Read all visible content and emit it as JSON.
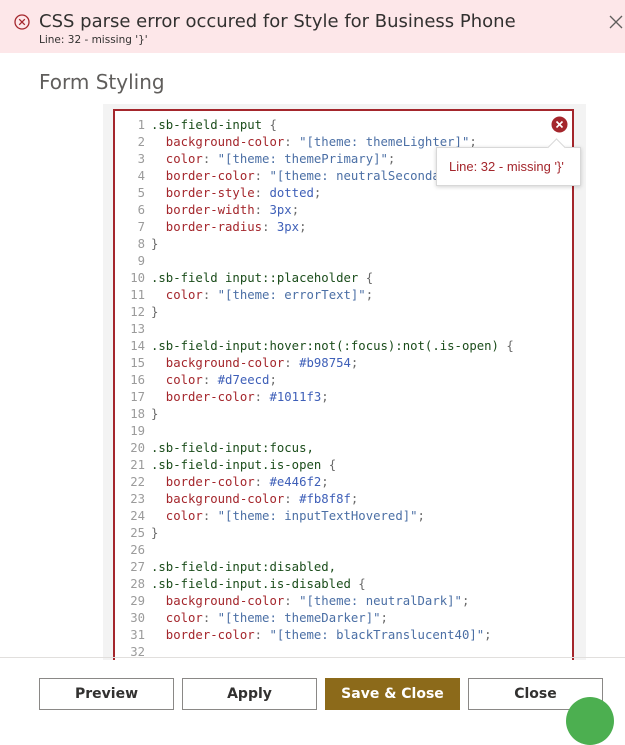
{
  "banner": {
    "title": "CSS parse error occured for Style for Business Phone",
    "subtitle": "Line: 32 - missing '}'",
    "icon": "error-circle-icon",
    "close_icon": "close-icon",
    "bg_color": "#fde7e9"
  },
  "section": {
    "title": "Form Styling"
  },
  "editor": {
    "error_tooltip": "Line: 32 - missing '}'",
    "border_color": "#a4262c",
    "lines": [
      {
        "n": "1",
        "segs": [
          [
            "sel",
            ".sb-field-input "
          ],
          [
            "brace",
            "{"
          ]
        ]
      },
      {
        "n": "2",
        "segs": [
          [
            "prop",
            "  background-color"
          ],
          [
            "punc",
            ": "
          ],
          [
            "str",
            "\"[theme: themeLighter]\""
          ],
          [
            "punc",
            ";"
          ]
        ]
      },
      {
        "n": "3",
        "segs": [
          [
            "prop",
            "  color"
          ],
          [
            "punc",
            ": "
          ],
          [
            "str",
            "\"[theme: themePrimary]\""
          ],
          [
            "punc",
            ";"
          ]
        ]
      },
      {
        "n": "4",
        "segs": [
          [
            "prop",
            "  border-color"
          ],
          [
            "punc",
            ": "
          ],
          [
            "str",
            "\"[theme: neutralSecondary]\""
          ],
          [
            "punc",
            ";"
          ]
        ]
      },
      {
        "n": "5",
        "segs": [
          [
            "prop",
            "  border-style"
          ],
          [
            "punc",
            ": "
          ],
          [
            "val",
            "dotted"
          ],
          [
            "punc",
            ";"
          ]
        ]
      },
      {
        "n": "6",
        "segs": [
          [
            "prop",
            "  border-width"
          ],
          [
            "punc",
            ": "
          ],
          [
            "val",
            "3px"
          ],
          [
            "punc",
            ";"
          ]
        ]
      },
      {
        "n": "7",
        "segs": [
          [
            "prop",
            "  border-radius"
          ],
          [
            "punc",
            ": "
          ],
          [
            "val",
            "3px"
          ],
          [
            "punc",
            ";"
          ]
        ]
      },
      {
        "n": "8",
        "segs": [
          [
            "brace",
            "}"
          ]
        ]
      },
      {
        "n": "9",
        "segs": []
      },
      {
        "n": "10",
        "segs": [
          [
            "sel",
            ".sb-field input::placeholder "
          ],
          [
            "brace",
            "{"
          ]
        ]
      },
      {
        "n": "11",
        "segs": [
          [
            "prop",
            "  color"
          ],
          [
            "punc",
            ": "
          ],
          [
            "str",
            "\"[theme: errorText]\""
          ],
          [
            "punc",
            ";"
          ]
        ]
      },
      {
        "n": "12",
        "segs": [
          [
            "brace",
            "}"
          ]
        ]
      },
      {
        "n": "13",
        "segs": []
      },
      {
        "n": "14",
        "segs": [
          [
            "sel",
            ".sb-field-input:hover:not(:focus):not(.is-open) "
          ],
          [
            "brace",
            "{"
          ]
        ]
      },
      {
        "n": "15",
        "segs": [
          [
            "prop",
            "  background-color"
          ],
          [
            "punc",
            ": "
          ],
          [
            "val",
            "#b98754"
          ],
          [
            "punc",
            ";"
          ]
        ]
      },
      {
        "n": "16",
        "segs": [
          [
            "prop",
            "  color"
          ],
          [
            "punc",
            ": "
          ],
          [
            "val",
            "#d7eecd"
          ],
          [
            "punc",
            ";"
          ]
        ]
      },
      {
        "n": "17",
        "segs": [
          [
            "prop",
            "  border-color"
          ],
          [
            "punc",
            ": "
          ],
          [
            "val",
            "#1011f3"
          ],
          [
            "punc",
            ";"
          ]
        ]
      },
      {
        "n": "18",
        "segs": [
          [
            "brace",
            "}"
          ]
        ]
      },
      {
        "n": "19",
        "segs": []
      },
      {
        "n": "20",
        "segs": [
          [
            "sel",
            ".sb-field-input:focus,"
          ]
        ]
      },
      {
        "n": "21",
        "segs": [
          [
            "sel",
            ".sb-field-input.is-open "
          ],
          [
            "brace",
            "{"
          ]
        ]
      },
      {
        "n": "22",
        "segs": [
          [
            "prop",
            "  border-color"
          ],
          [
            "punc",
            ": "
          ],
          [
            "val",
            "#e446f2"
          ],
          [
            "punc",
            ";"
          ]
        ]
      },
      {
        "n": "23",
        "segs": [
          [
            "prop",
            "  background-color"
          ],
          [
            "punc",
            ": "
          ],
          [
            "val",
            "#fb8f8f"
          ],
          [
            "punc",
            ";"
          ]
        ]
      },
      {
        "n": "24",
        "segs": [
          [
            "prop",
            "  color"
          ],
          [
            "punc",
            ": "
          ],
          [
            "str",
            "\"[theme: inputTextHovered]\""
          ],
          [
            "punc",
            ";"
          ]
        ]
      },
      {
        "n": "25",
        "segs": [
          [
            "brace",
            "}"
          ]
        ]
      },
      {
        "n": "26",
        "segs": []
      },
      {
        "n": "27",
        "segs": [
          [
            "sel",
            ".sb-field-input:disabled,"
          ]
        ]
      },
      {
        "n": "28",
        "segs": [
          [
            "sel",
            ".sb-field-input.is-disabled "
          ],
          [
            "brace",
            "{"
          ]
        ]
      },
      {
        "n": "29",
        "segs": [
          [
            "prop",
            "  background-color"
          ],
          [
            "punc",
            ": "
          ],
          [
            "str",
            "\"[theme: neutralDark]\""
          ],
          [
            "punc",
            ";"
          ]
        ]
      },
      {
        "n": "30",
        "segs": [
          [
            "prop",
            "  color"
          ],
          [
            "punc",
            ": "
          ],
          [
            "str",
            "\"[theme: themeDarker]\""
          ],
          [
            "punc",
            ";"
          ]
        ]
      },
      {
        "n": "31",
        "segs": [
          [
            "prop",
            "  border-color"
          ],
          [
            "punc",
            ": "
          ],
          [
            "str",
            "\"[theme: blackTranslucent40]\""
          ],
          [
            "punc",
            ";"
          ]
        ]
      },
      {
        "n": "32",
        "segs": []
      }
    ]
  },
  "footer": {
    "preview_label": "Preview",
    "apply_label": "Apply",
    "save_close_label": "Save & Close",
    "close_label": "Close",
    "primary_color": "#8c6a1a"
  }
}
